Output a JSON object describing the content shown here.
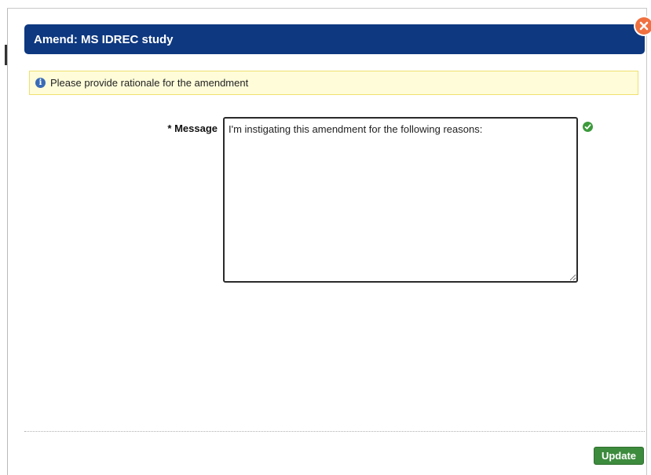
{
  "dialog": {
    "title": "Amend: MS IDREC study",
    "close_icon": "close-x-icon"
  },
  "info_banner": {
    "icon": "info-circle-icon",
    "text": "Please provide rationale for the amendment"
  },
  "form": {
    "message_label": "* Message",
    "message_value": "I'm instigating this amendment for the following reasons:",
    "valid_icon": "check-circle-icon"
  },
  "footer": {
    "update_label": "Update"
  },
  "colors": {
    "header_bg": "#0e3880",
    "banner_bg": "#fefcd9",
    "update_bg": "#3d8b3d",
    "close_bg": "#f07040",
    "valid_green": "#3c9a3c"
  }
}
